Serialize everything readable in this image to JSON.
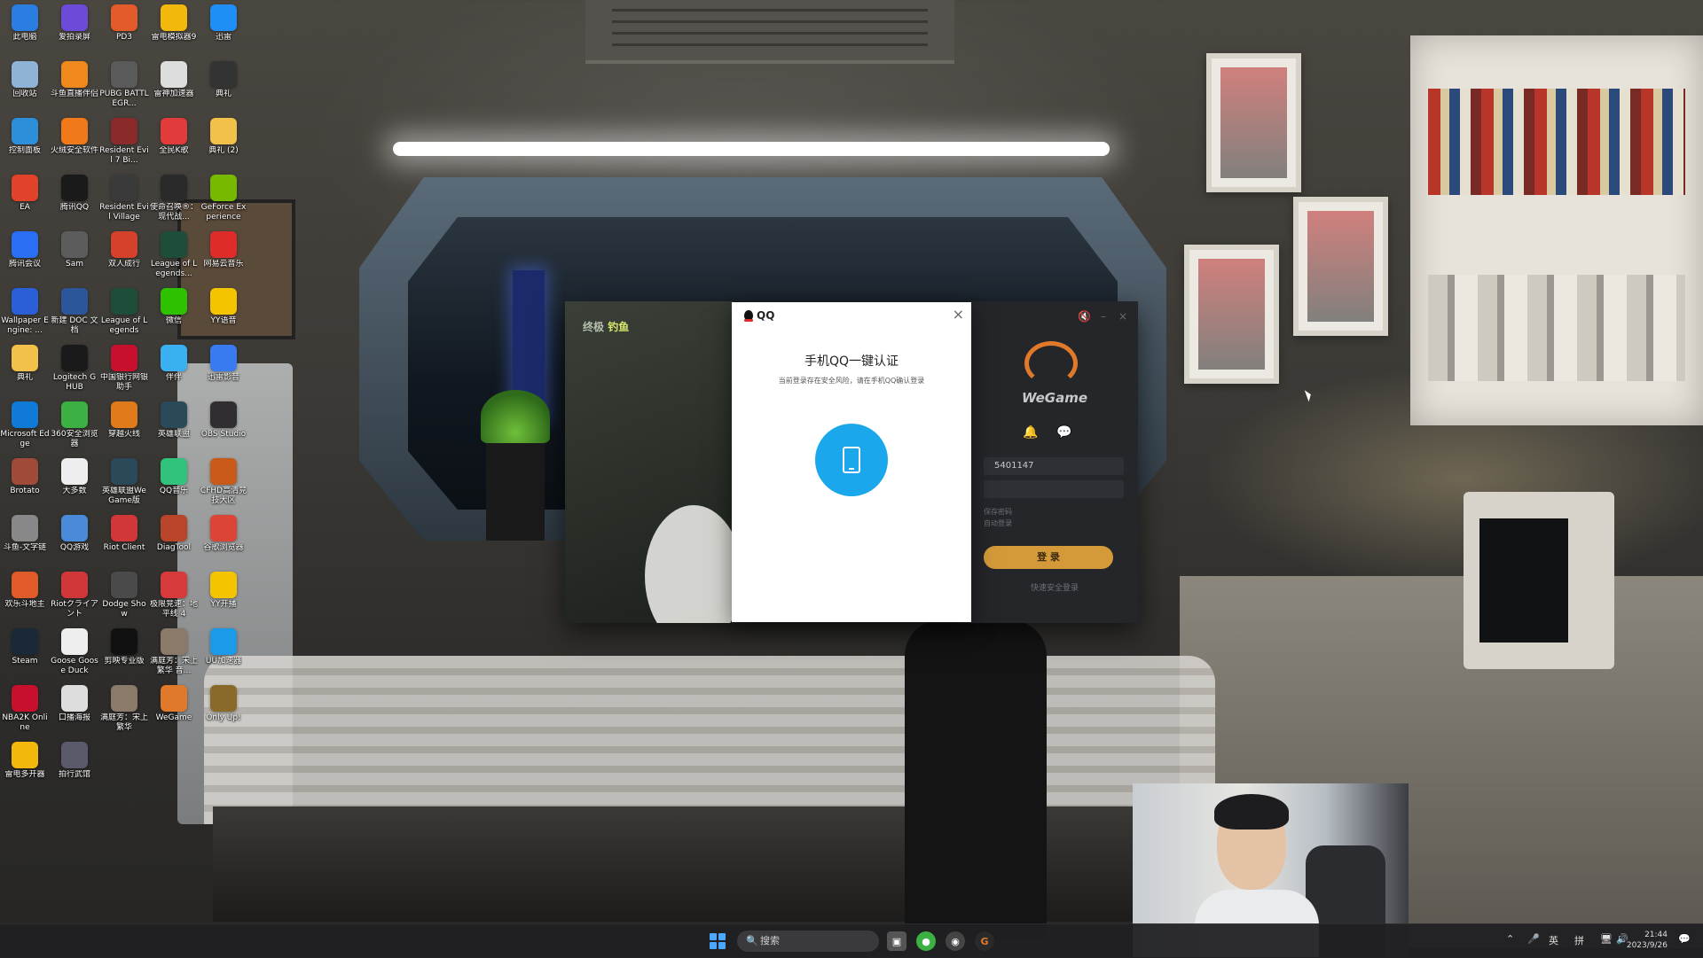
{
  "desktop_icons": [
    {
      "label": "此电脑",
      "color": "#2a7de1"
    },
    {
      "label": "爱拍录屏",
      "color": "#6c4bd8"
    },
    {
      "label": "PD3",
      "color": "#e35b2a"
    },
    {
      "label": "雷电模拟器9",
      "color": "#f2b90c"
    },
    {
      "label": "迅雷",
      "color": "#1f8ef5"
    },
    {
      "label": "回收站",
      "color": "#8fb3d6"
    },
    {
      "label": "斗鱼直播伴侣",
      "color": "#f0891c"
    },
    {
      "label": "PUBG BATTLEGR...",
      "color": "#5a5a5a"
    },
    {
      "label": "雷神加速器",
      "color": "#dddddd"
    },
    {
      "label": "典礼",
      "color": "#333333"
    },
    {
      "label": "控制面板",
      "color": "#2d8fd9"
    },
    {
      "label": "火绒安全软件",
      "color": "#f07a1a"
    },
    {
      "label": "Resident Evil 7 Bi...",
      "color": "#8a2a2a"
    },
    {
      "label": "全民K歌",
      "color": "#e23b3b"
    },
    {
      "label": "典礼 (2)",
      "color": "#f2c14a"
    },
    {
      "label": "EA",
      "color": "#e0432a"
    },
    {
      "label": "腾讯QQ",
      "color": "#1a1a1a"
    },
    {
      "label": "Resident Evil Village",
      "color": "#3a3a3a"
    },
    {
      "label": "使命召唤®：现代战...",
      "color": "#2a2a2a"
    },
    {
      "label": "GeForce Experience",
      "color": "#76b900"
    },
    {
      "label": "腾讯会议",
      "color": "#2a6ef5"
    },
    {
      "label": "Sam",
      "color": "#5c5c5c"
    },
    {
      "label": "双人成行",
      "color": "#d6412b"
    },
    {
      "label": "League of Legends...",
      "color": "#1e4d3a"
    },
    {
      "label": "网易云音乐",
      "color": "#e02b2b"
    },
    {
      "label": "Wallpaper Engine: ...",
      "color": "#2a5fd8"
    },
    {
      "label": "新建 DOC 文档",
      "color": "#2b579a"
    },
    {
      "label": "League of Legends",
      "color": "#1e4d3a"
    },
    {
      "label": "微信",
      "color": "#2dc100"
    },
    {
      "label": "YY语音",
      "color": "#f5c400"
    },
    {
      "label": "典礼",
      "color": "#f2c14a"
    },
    {
      "label": "Logitech G HUB",
      "color": "#1a1a1a"
    },
    {
      "label": "中国银行网银助手",
      "color": "#c8102e"
    },
    {
      "label": "伴伴",
      "color": "#3ab0f0"
    },
    {
      "label": "迅雷影音",
      "color": "#3a7af0"
    },
    {
      "label": "Microsoft Edge",
      "color": "#0f7bd6"
    },
    {
      "label": "360安全浏览器",
      "color": "#3cb043"
    },
    {
      "label": "穿越火线",
      "color": "#e07a1a"
    },
    {
      "label": "英雄联盟",
      "color": "#2a4a5a"
    },
    {
      "label": "OBS Studio",
      "color": "#302e31"
    },
    {
      "label": "Brotato",
      "color": "#a04a3a"
    },
    {
      "label": "大多数",
      "color": "#eeeeee"
    },
    {
      "label": "英雄联盟WeGame版",
      "color": "#2a4a5a"
    },
    {
      "label": "QQ音乐",
      "color": "#31c27c"
    },
    {
      "label": "CFHD高清竞技大区",
      "color": "#c85a1a"
    },
    {
      "label": "斗鱼-文字链",
      "color": "#888888"
    },
    {
      "label": "QQ游戏",
      "color": "#4a8ad8"
    },
    {
      "label": "Riot Client",
      "color": "#d13639"
    },
    {
      "label": "DiagTool",
      "color": "#b8452a"
    },
    {
      "label": "谷歌浏览器",
      "color": "#db4437"
    },
    {
      "label": "欢乐斗地主",
      "color": "#e05a2a"
    },
    {
      "label": "Riotクライアント",
      "color": "#d13639"
    },
    {
      "label": "Dodge Show",
      "color": "#4a4a4a"
    },
    {
      "label": "极限竞速：地平线 4",
      "color": "#d63a3a"
    },
    {
      "label": "YY开播",
      "color": "#f5c400"
    },
    {
      "label": "Steam",
      "color": "#1b2838"
    },
    {
      "label": "Goose Goose Duck",
      "color": "#eeeeee"
    },
    {
      "label": "剪映专业版",
      "color": "#111111"
    },
    {
      "label": "满庭芳：宋上繁华 音...",
      "color": "#8a7a6a"
    },
    {
      "label": "UU加速器",
      "color": "#1a9ae8"
    },
    {
      "label": "NBA2K Online",
      "color": "#c8102e"
    },
    {
      "label": "口播海报",
      "color": "#dddddd"
    },
    {
      "label": "满庭芳：宋上繁华",
      "color": "#8a7a6a"
    },
    {
      "label": "WeGame",
      "color": "#e07a2a"
    },
    {
      "label": "Only Up!",
      "color": "#8a6a2a"
    },
    {
      "label": "雷电多开器",
      "color": "#f2b90c"
    },
    {
      "label": "拍行武馆",
      "color": "#5a5a6a"
    }
  ],
  "wegame": {
    "left_tag_a": "终极",
    "left_tag_b": "钓鱼",
    "mute_icon": "speaker-mute-icon",
    "minimize": "–",
    "close": "×",
    "brand": "WeGame",
    "account": "5401147",
    "remember_password": "保存密码",
    "auto_login": "自动登录",
    "login_button": "登 录",
    "quick_login": "快速安全登录"
  },
  "qq_dialog": {
    "brand": "QQ",
    "close": "×",
    "title": "手机QQ一键认证",
    "subtitle": "当前登录存在安全风险，请在手机QQ确认登录"
  },
  "taskbar": {
    "search_placeholder": "搜索",
    "ime_lang": "英",
    "ime_mode": "拼",
    "time": "21:44",
    "date": "2023/9/26"
  },
  "colors": {
    "qq_blue": "#1aa7ec",
    "wegame_orange": "#d49a3a",
    "taskbar_bg": "#202022"
  }
}
